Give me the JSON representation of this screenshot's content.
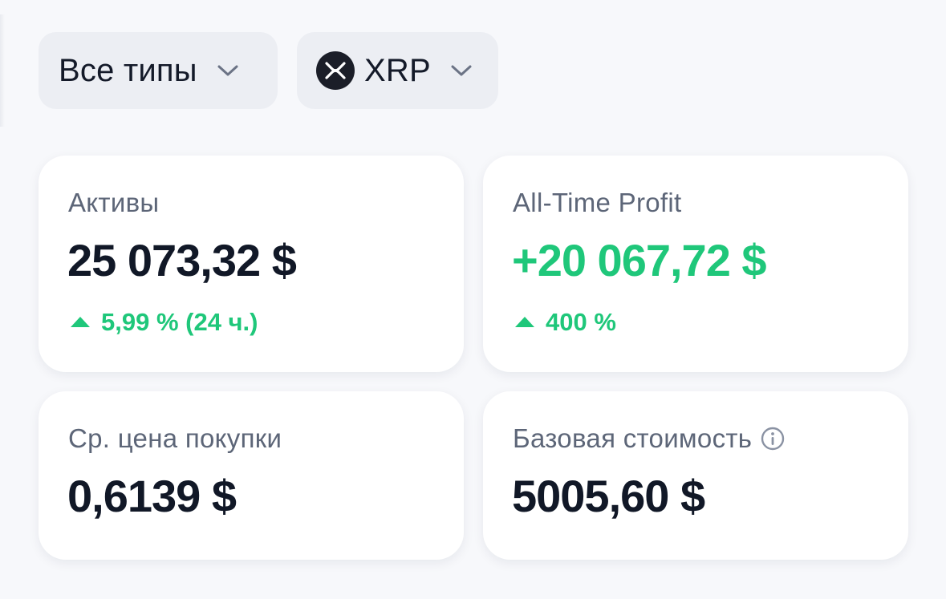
{
  "filters": {
    "types_label": "Все типы",
    "coin_label": "XRP",
    "coin_icon": "xrp-logo-icon",
    "chevron_icon": "chevron-down-icon"
  },
  "cards": {
    "assets": {
      "title": "Активы",
      "value": "25 073,32 $",
      "change": "5,99 % (24 ч.)",
      "change_icon": "triangle-up-icon"
    },
    "profit": {
      "title": "All-Time Profit",
      "value": "+20 067,72 $",
      "change": "400 %",
      "change_icon": "triangle-up-icon"
    },
    "avg_price": {
      "title": "Ср. цена покупки",
      "value": "0,6139 $"
    },
    "base_cost": {
      "title": "Базовая стоимость",
      "value": "5005,60 $",
      "info_icon": "info-icon"
    }
  },
  "colors": {
    "background": "#f7f8fb",
    "chip": "#eceef3",
    "card": "#ffffff",
    "text_primary": "#111827",
    "text_secondary": "#5d6678",
    "positive": "#1fc77a"
  }
}
